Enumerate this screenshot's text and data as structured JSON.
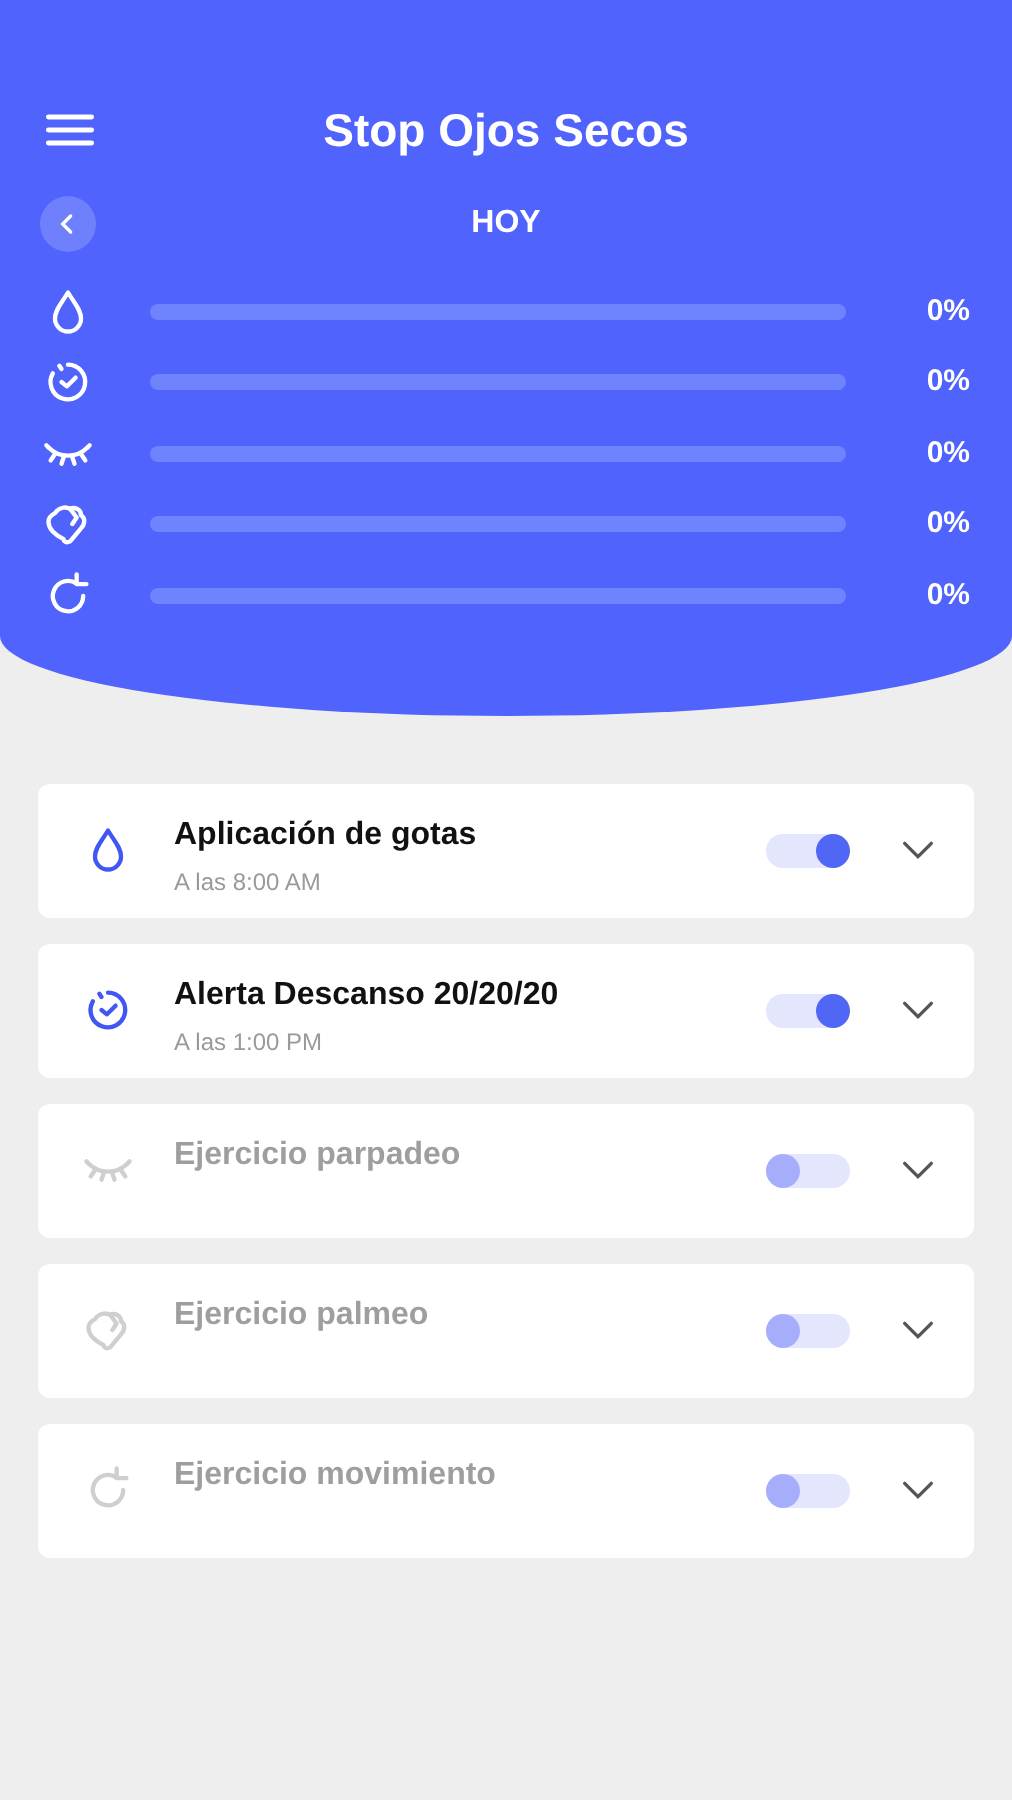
{
  "header": {
    "title": "Stop Ojos Secos",
    "day": "HOY"
  },
  "progress": [
    {
      "level": 0,
      "reading": "0%"
    },
    {
      "level": 0,
      "reading": "0%"
    },
    {
      "level": 0,
      "reading": "0%"
    },
    {
      "level": 0,
      "reading": "0%"
    },
    {
      "level": 0,
      "reading": "0%"
    }
  ],
  "reminders": [
    {
      "title": "Aplicación de gotas",
      "time": "A las 8:00 AM",
      "on": true
    },
    {
      "title": "Alerta Descanso 20/20/20",
      "time": "A las 1:00 PM",
      "on": true
    },
    {
      "title": "Ejercicio parpadeo",
      "on": false
    },
    {
      "title": "Ejercicio palmeo",
      "on": false
    },
    {
      "title": "Ejercicio movimiento",
      "on": false
    }
  ]
}
